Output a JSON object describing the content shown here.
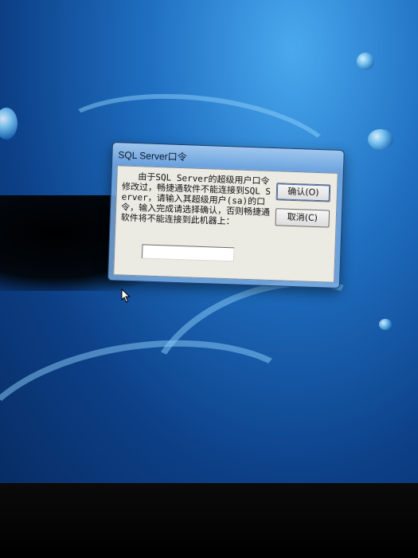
{
  "dialog": {
    "title": "SQL Server口令",
    "message": "   由于SQL Server的超级用户口令修改过，畅捷通软件不能连接到SQL Server，请输入其超级用户(sa)的口令，输入完成请选择确认，否则畅捷通软件将不能连接到此机器上：",
    "password_value": "",
    "ok_label": "确认(O)",
    "cancel_label": "取消(C)"
  },
  "colors": {
    "desktop_primary": "#1f6fc1",
    "dialog_client_bg": "#ebeae3",
    "frame_tint": "#78aae1"
  },
  "icons": {
    "cursor": "mouse-pointer-icon"
  }
}
